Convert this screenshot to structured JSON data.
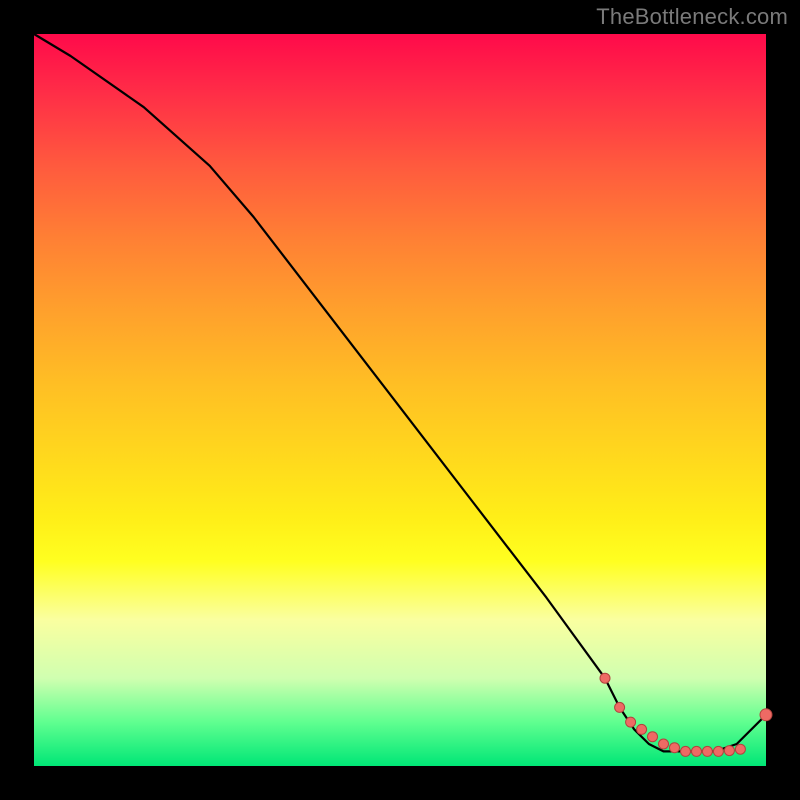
{
  "watermark": "TheBottleneck.com",
  "colors": {
    "page_bg": "#000000",
    "curve": "#000000",
    "point_fill": "#ee6a64",
    "point_stroke": "#b2433e",
    "gradient_top": "#ff0a4a",
    "gradient_bottom": "#00e676"
  },
  "chart_data": {
    "type": "line",
    "title": "",
    "xlabel": "",
    "ylabel": "",
    "xlim": [
      0,
      100
    ],
    "ylim": [
      0,
      100
    ],
    "grid": false,
    "legend": false,
    "series": [
      {
        "name": "curve",
        "style": "line",
        "x": [
          0,
          5,
          15,
          24,
          30,
          40,
          50,
          60,
          70,
          78,
          80,
          82,
          84,
          86,
          88,
          90,
          93,
          96,
          100
        ],
        "y": [
          100,
          97,
          90,
          82,
          75,
          62,
          49,
          36,
          23,
          12,
          8,
          5,
          3,
          2,
          2,
          2,
          2,
          3,
          7
        ]
      },
      {
        "name": "points",
        "style": "scatter",
        "x": [
          78,
          80,
          81.5,
          83,
          84.5,
          86,
          87.5,
          89,
          90.5,
          92,
          93.5,
          95,
          96.5,
          100
        ],
        "y": [
          12,
          8,
          6,
          5,
          4,
          3,
          2.5,
          2,
          2,
          2,
          2,
          2.1,
          2.3,
          7
        ]
      }
    ],
    "annotations": []
  }
}
